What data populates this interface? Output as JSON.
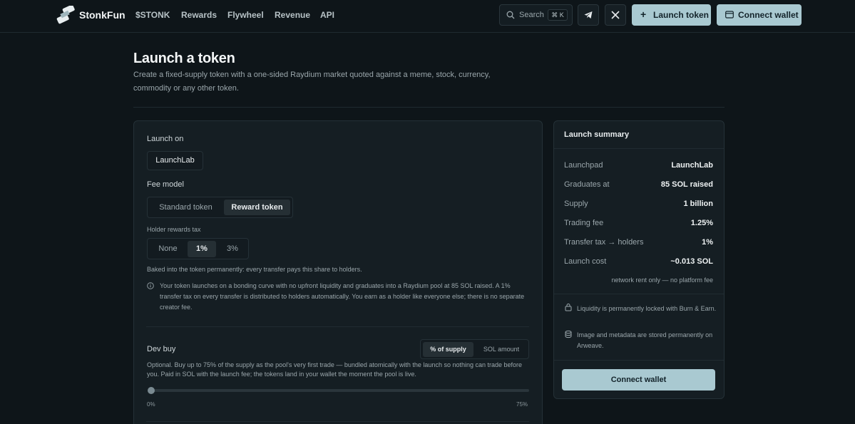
{
  "header": {
    "brand": "StonkFun",
    "nav": [
      "$STONK",
      "Rewards",
      "Flywheel",
      "Revenue",
      "API"
    ],
    "search_label": "Search",
    "search_shortcut": "⌘ K",
    "launch_label": "Launch token",
    "connect_label": "Connect wallet",
    "colors": {
      "accent": "#a9c9d1",
      "background": "#0e1519"
    }
  },
  "page": {
    "title": "Launch a token",
    "subtitle": "Create a fixed-supply token with a one-sided Raydium market quoted against a meme, stock, currency, commodity or any other token."
  },
  "form": {
    "launch_on_label": "Launch on",
    "launch_on_value": "LaunchLab",
    "fee_model_label": "Fee model",
    "fee_model_options": [
      "Standard token",
      "Reward token"
    ],
    "fee_model_selected": "Reward token",
    "holder_tax_label": "Holder rewards tax",
    "holder_tax_options": [
      "None",
      "1%",
      "3%"
    ],
    "holder_tax_selected": "1%",
    "tax_note": "Baked into the token permanently: every transfer pays this share to holders.",
    "info_note": "Your token launches on a bonding curve with no upfront liquidity and graduates into a Raydium pool at 85 SOL raised. A 1% transfer tax on every transfer is distributed to holders automatically. You earn as a holder like everyone else; there is no separate creator fee.",
    "dev_buy_label": "Dev buy",
    "dev_buy_modes": [
      "% of supply",
      "SOL amount"
    ],
    "dev_buy_mode_selected": "% of supply",
    "dev_buy_note": "Optional. Buy up to 75% of the supply as the pool's very first trade — bundled atomically with the launch so nothing can trade before you. Paid in SOL with the launch fee; the tokens land in your wallet the moment the pool is live.",
    "slider_min": "0%",
    "slider_max": "75%",
    "slider_value_fraction": 0
  },
  "summary": {
    "title": "Launch summary",
    "rows": [
      {
        "key": "Launchpad",
        "value": "LaunchLab"
      },
      {
        "key": "Graduates at",
        "value": "85 SOL raised"
      },
      {
        "key": "Supply",
        "value": "1 billion"
      },
      {
        "key": "Trading fee",
        "value": "1.25%"
      },
      {
        "key": "Transfer tax → holders",
        "value": "1%"
      },
      {
        "key": "Launch cost",
        "value": "~0.013 SOL"
      }
    ],
    "rent_note": "network rent only — no platform fee",
    "features": [
      "Liquidity is permanently locked with Burn & Earn.",
      "Image and metadata are stored permanently on Arweave."
    ],
    "connect_label": "Connect wallet"
  }
}
